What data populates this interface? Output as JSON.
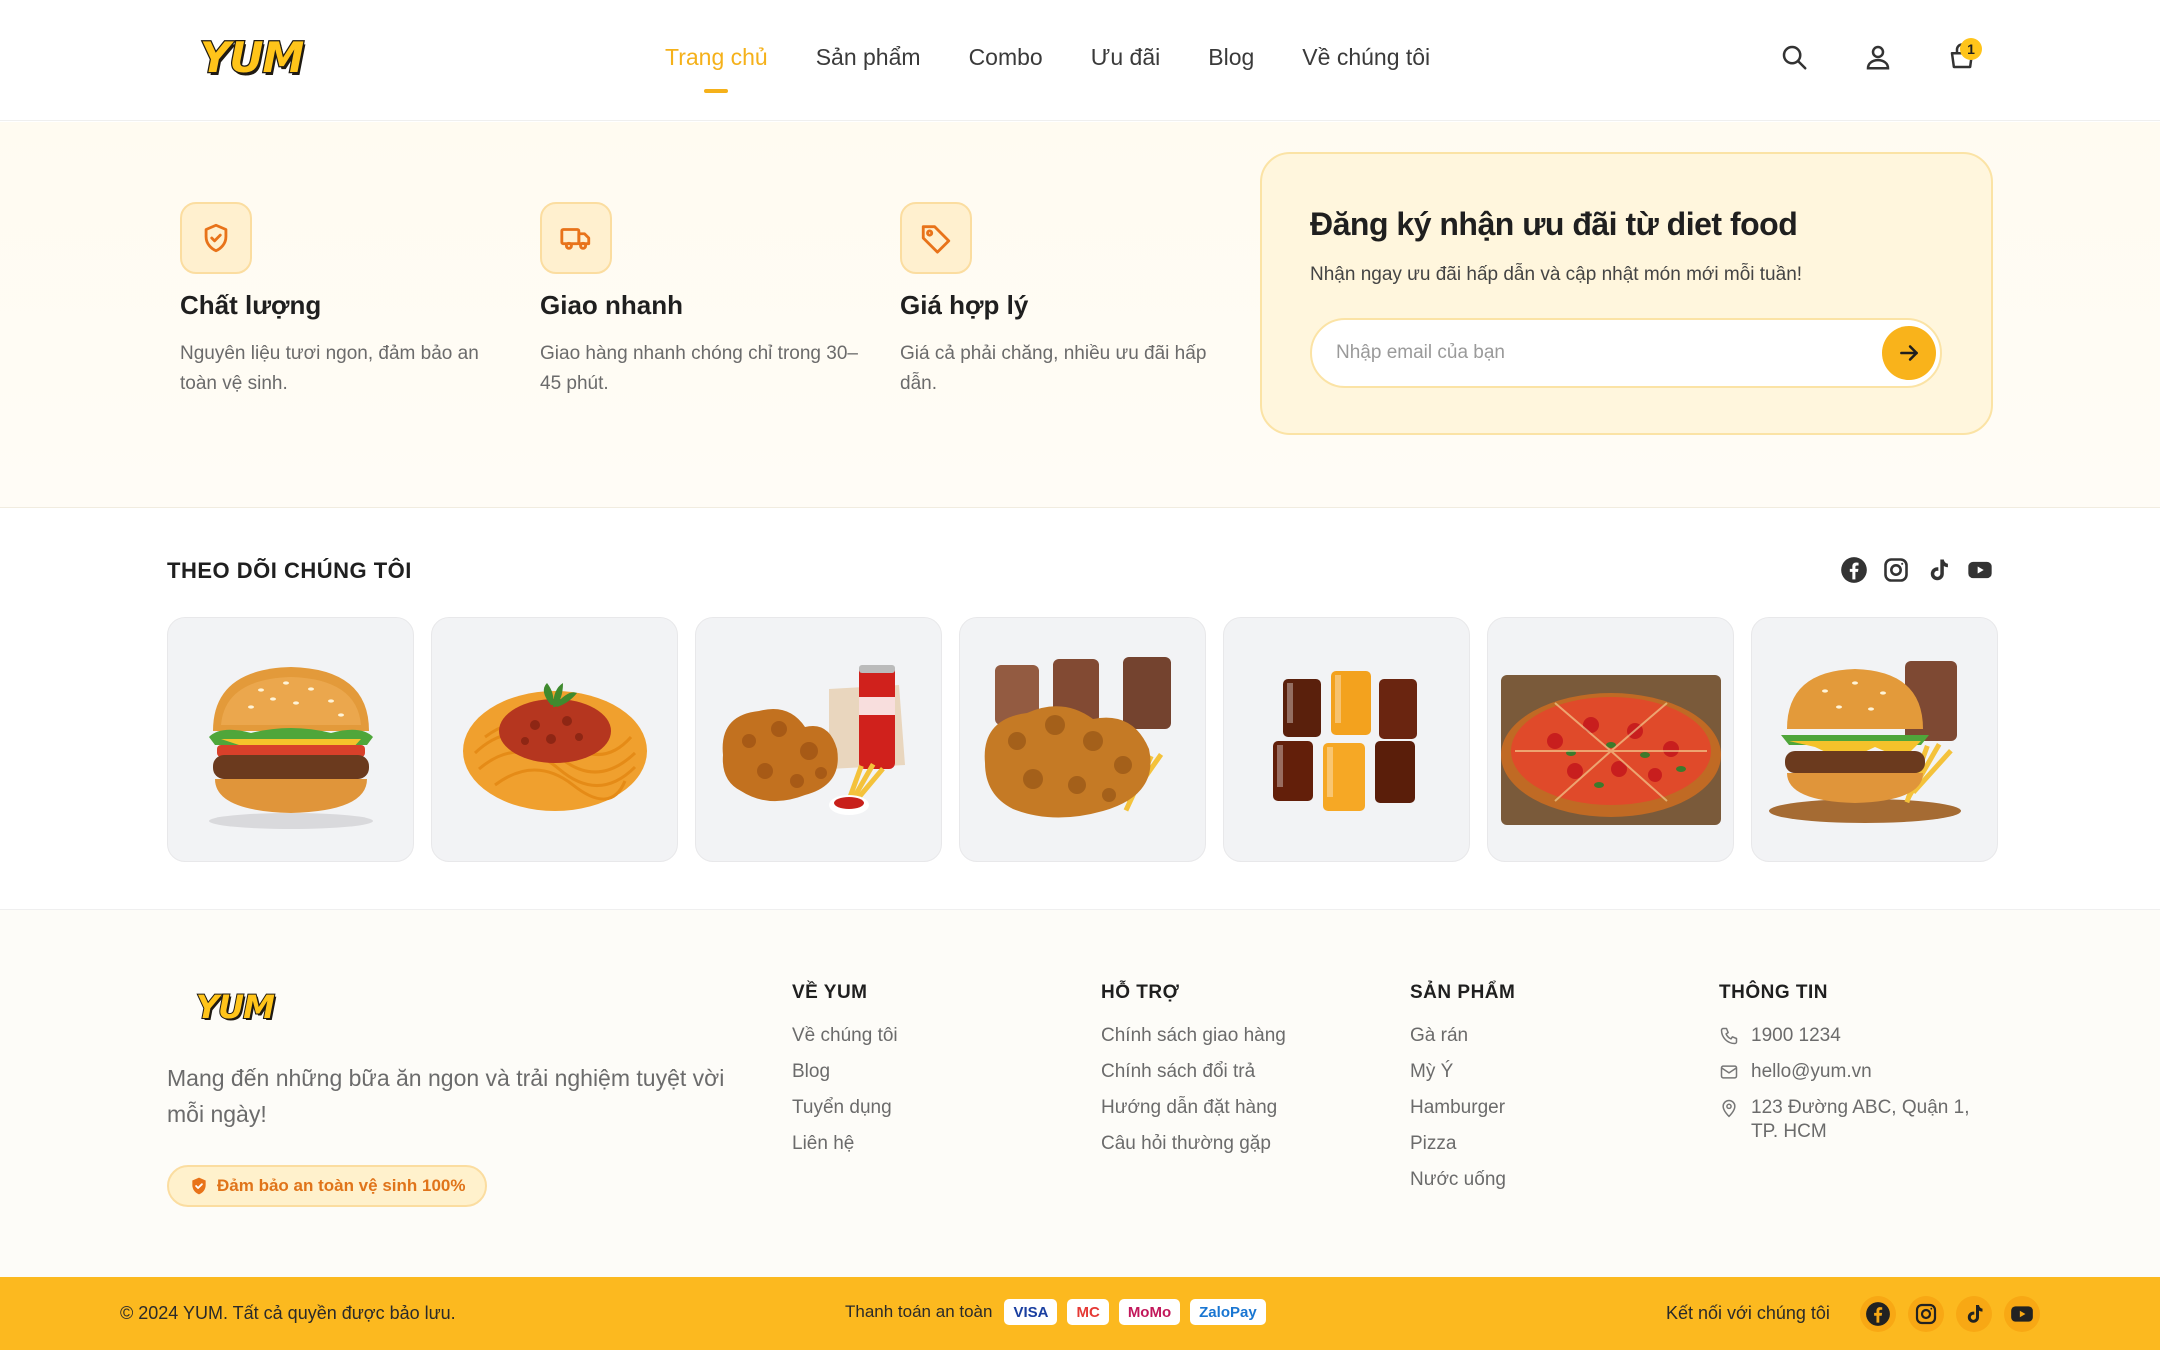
{
  "brand": {
    "logo_text": "YUM",
    "accent": "#F9B31B",
    "footer_bar": "#FCB91F"
  },
  "nav": {
    "items": [
      "Trang chủ",
      "Sản phẩm",
      "Combo",
      "Ưu đãi",
      "Blog",
      "Về chúng tôi"
    ],
    "active": "Trang chủ"
  },
  "header_icons": [
    "search-icon",
    "user-icon",
    "cart-icon"
  ],
  "cart": {
    "count": "1"
  },
  "features": [
    {
      "icon": "shield-check-icon",
      "title": "Chất lượng",
      "desc": "Nguyên liệu tươi ngon, đảm bảo an toàn vệ sinh."
    },
    {
      "icon": "truck-icon",
      "title": "Giao nhanh",
      "desc": "Giao hàng nhanh chóng chỉ trong 30–45 phút."
    },
    {
      "icon": "tag-icon",
      "title": "Giá hợp lý",
      "desc": "Giá cả phải chăng, nhiều ưu đãi hấp dẫn."
    }
  ],
  "newsletter": {
    "title": "Đăng ký nhận ưu đãi từ diet food",
    "subtitle": "Nhận ngay ưu đãi hấp dẫn và cập nhật món mới mỗi tuần!",
    "placeholder": "Nhập email của bạn"
  },
  "follow": {
    "title": "THEO DÕI CHÚNG TÔI",
    "socials": [
      "facebook-icon",
      "instagram-icon",
      "tiktok-icon",
      "youtube-icon"
    ],
    "gallery": [
      "burger",
      "spaghetti",
      "fried-chicken-cola",
      "fried-chicken-drinks",
      "drinks",
      "pizza",
      "burger-combo"
    ]
  },
  "footer": {
    "tagline": "Mang đến những bữa ăn ngon và trải nghiệm tuyệt vời mỗi ngày!",
    "badge": "Đảm bảo an toàn vệ sinh 100%",
    "columns": [
      {
        "title": "VỀ YUM",
        "links": [
          "Về chúng tôi",
          "Blog",
          "Tuyển dụng",
          "Liên hệ"
        ]
      },
      {
        "title": "HỖ TRỢ",
        "links": [
          "Chính sách giao hàng",
          "Chính sách đổi trả",
          "Hướng dẫn đặt hàng",
          "Câu hỏi thường gặp"
        ]
      },
      {
        "title": "SẢN PHẨM",
        "links": [
          "Gà rán",
          "Mỳ Ý",
          "Hamburger",
          "Pizza",
          "Nước uống"
        ]
      }
    ],
    "info": {
      "title": "THÔNG TIN",
      "phone": "1900 1234",
      "email": "hello@yum.vn",
      "address": "123 Đường ABC, Quận 1, TP. HCM"
    }
  },
  "bottom_bar": {
    "copyright": "© 2024 YUM. Tất cả quyền được bảo lưu.",
    "payment_label": "Thanh toán an toàn",
    "payments": [
      {
        "name": "VISA",
        "color": "#1A3FA0"
      },
      {
        "name": "MC",
        "color": "#E53935"
      },
      {
        "name": "MoMo",
        "color": "#C2185B"
      },
      {
        "name": "ZaloPay",
        "color": "#1976D2"
      }
    ],
    "connect_label": "Kết nối với chúng tôi"
  }
}
